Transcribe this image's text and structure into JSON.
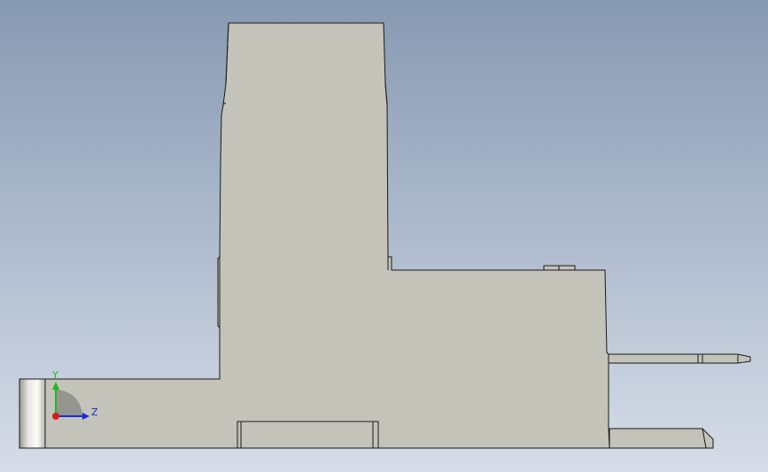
{
  "viewport": {
    "background_top": "#8799b2",
    "background_bottom": "#d6dde8"
  },
  "model": {
    "face_color": "#c3c3b9",
    "edge_color": "#1a1a1a",
    "highlight_color": "#f0f0ec"
  },
  "triad": {
    "y_label": "Y",
    "z_label": "Z",
    "y_color": "#1cb81c",
    "z_color": "#1b2bd6",
    "x_color": "#d81c1c"
  }
}
